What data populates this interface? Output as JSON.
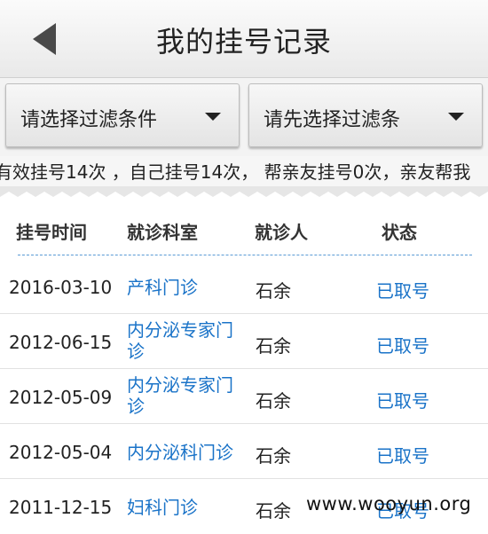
{
  "header": {
    "title": "我的挂号记录"
  },
  "filters": {
    "first": "请选择过滤条件",
    "second": "请先选择过滤条"
  },
  "summary": "有效挂号14次 ，自己挂号14次， 帮亲友挂号0次，亲友帮我",
  "table": {
    "headers": [
      "挂号时间",
      "就诊科室",
      "就诊人",
      "状态"
    ],
    "rows": [
      {
        "date": "2016-03-10",
        "department": "产科门诊",
        "patient": "石余",
        "status": "已取号"
      },
      {
        "date": "2012-06-15",
        "department": "内分泌专家门诊",
        "patient": "石余",
        "status": "已取号"
      },
      {
        "date": "2012-05-09",
        "department": "内分泌专家门诊",
        "patient": "石余",
        "status": "已取号"
      },
      {
        "date": "2012-05-04",
        "department": "内分泌科门诊",
        "patient": "石余",
        "status": "已取号"
      },
      {
        "date": "2011-12-15",
        "department": "妇科门诊",
        "patient": "石余",
        "status": "已取号"
      }
    ]
  },
  "watermark": "www.wooyun.org",
  "colors": {
    "link": "#1a73c8",
    "divider": "#5a9bd5"
  }
}
